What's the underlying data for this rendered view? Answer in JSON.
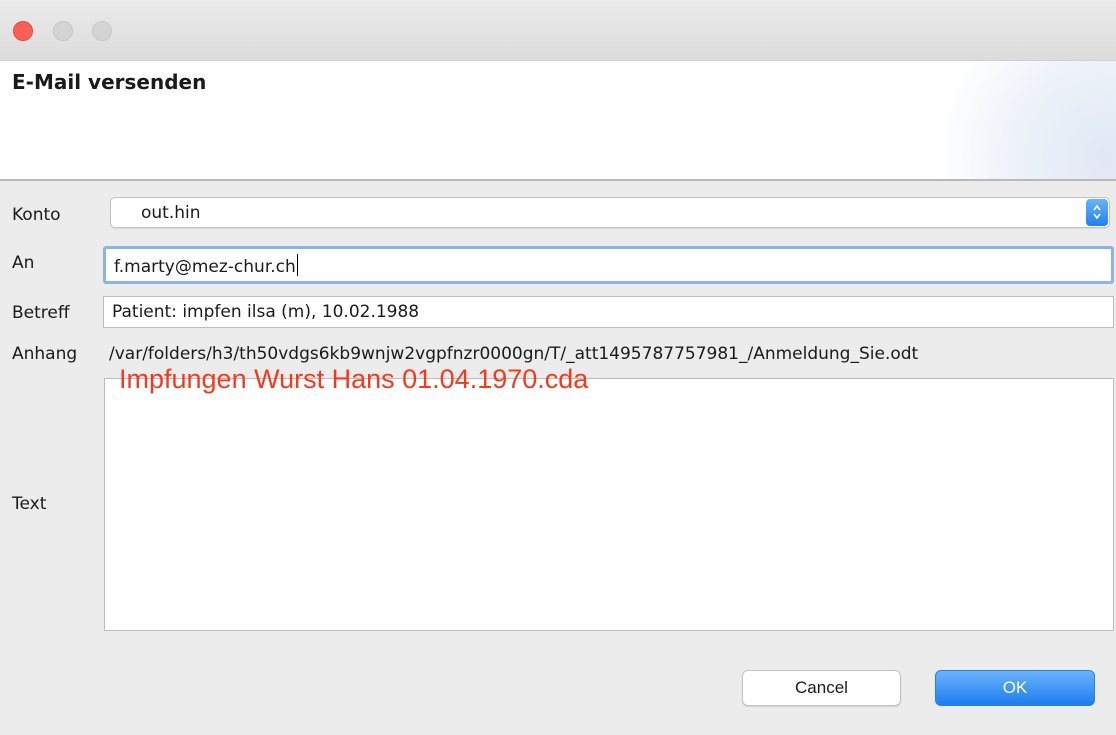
{
  "dialog": {
    "title": "E-Mail versenden"
  },
  "form": {
    "konto": {
      "label": "Konto",
      "value": "out.hin"
    },
    "an": {
      "label": "An",
      "value": "f.marty@mez-chur.ch"
    },
    "betreff": {
      "label": "Betreff",
      "value": "Patient: impfen ilsa (m), 10.02.1988"
    },
    "anhang": {
      "label": "Anhang",
      "value": "/var/folders/h3/th50vdgs6kb9wnjw2vgpfnzr0000gn/T/_att1495787757981_/Anmeldung_Sie.odt",
      "overlay_value": "Impfungen Wurst Hans 01.04.1970.cda"
    },
    "text": {
      "label": "Text",
      "value": ""
    }
  },
  "buttons": {
    "cancel_label": "Cancel",
    "ok_label": "OK"
  },
  "colors": {
    "accent": "#1c7df0",
    "overlay_text": "#f23a1e",
    "close_button": "#fc5f57"
  },
  "icons": {
    "select_arrow": "updown-chevron-icon"
  }
}
